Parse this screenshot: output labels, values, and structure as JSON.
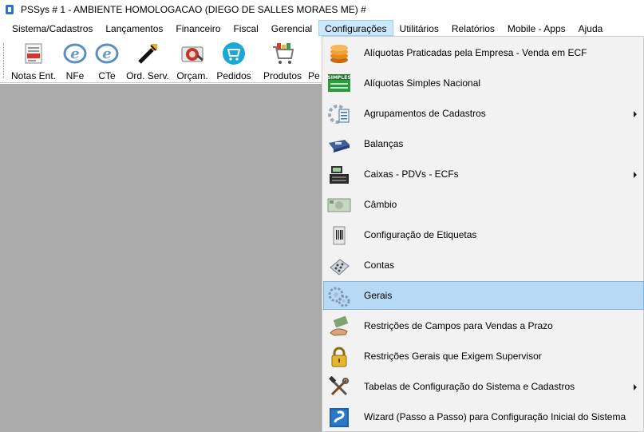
{
  "window": {
    "title": "PSSys # 1 - AMBIENTE HOMOLOGACAO (DIEGO DE SALLES MORAES ME) #"
  },
  "menubar": [
    {
      "label": "Sistema/Cadastros"
    },
    {
      "label": "Lançamentos"
    },
    {
      "label": "Financeiro"
    },
    {
      "label": "Fiscal"
    },
    {
      "label": "Gerencial"
    },
    {
      "label": "Configurações",
      "active": true
    },
    {
      "label": "Utilitários"
    },
    {
      "label": "Relatórios"
    },
    {
      "label": "Mobile - Apps"
    },
    {
      "label": "Ajuda"
    }
  ],
  "toolbar": [
    {
      "label": "Notas Ent.",
      "icon": "nota-icon"
    },
    {
      "label": "NFe",
      "icon": "nfe-icon"
    },
    {
      "label": "CTe",
      "icon": "cte-icon"
    },
    {
      "label": "Ord. Serv.",
      "icon": "wrench-icon"
    },
    {
      "label": "Orçam.",
      "icon": "orcamento-icon"
    },
    {
      "label": "Pedidos",
      "icon": "pedidos-icon"
    },
    {
      "label": "Produtos",
      "icon": "cart-icon"
    },
    {
      "label": "Pe",
      "icon": "partial-icon"
    }
  ],
  "dropdown": {
    "items": [
      {
        "label": "Alíquotas Praticadas pela Empresa - Venda em ECF",
        "icon": "coins-icon",
        "submenu": false
      },
      {
        "label": "Alíquotas Simples Nacional",
        "icon": "simples-icon",
        "submenu": false
      },
      {
        "label": "Agrupamentos de Cadastros",
        "icon": "groups-icon",
        "submenu": true
      },
      {
        "label": "Balanças",
        "icon": "scale-icon",
        "submenu": false
      },
      {
        "label": "Caixas - PDVs - ECFs",
        "icon": "register-icon",
        "submenu": true
      },
      {
        "label": "Câmbio",
        "icon": "money-icon",
        "submenu": false
      },
      {
        "label": "Configuração de Etiquetas",
        "icon": "label-icon",
        "submenu": false
      },
      {
        "label": "Contas",
        "icon": "calculator-icon",
        "submenu": false
      },
      {
        "label": "Gerais",
        "icon": "gears-icon",
        "submenu": false,
        "highlighted": true
      },
      {
        "label": "Restrições de Campos para Vendas a Prazo",
        "icon": "hand-money-icon",
        "submenu": false
      },
      {
        "label": "Restrições Gerais que Exigem Supervisor",
        "icon": "lock-icon",
        "submenu": false
      },
      {
        "label": "Tabelas de Configuração do Sistema e Cadastros",
        "icon": "tools-icon",
        "submenu": true
      },
      {
        "label": "Wizard (Passo a Passo) para Configuração Inicial do Sistema",
        "icon": "wizard-icon",
        "submenu": false
      }
    ]
  },
  "colors": {
    "workspace": "#ababab",
    "highlight": "#b7d9f3",
    "menu_active": "#cce8ff"
  }
}
